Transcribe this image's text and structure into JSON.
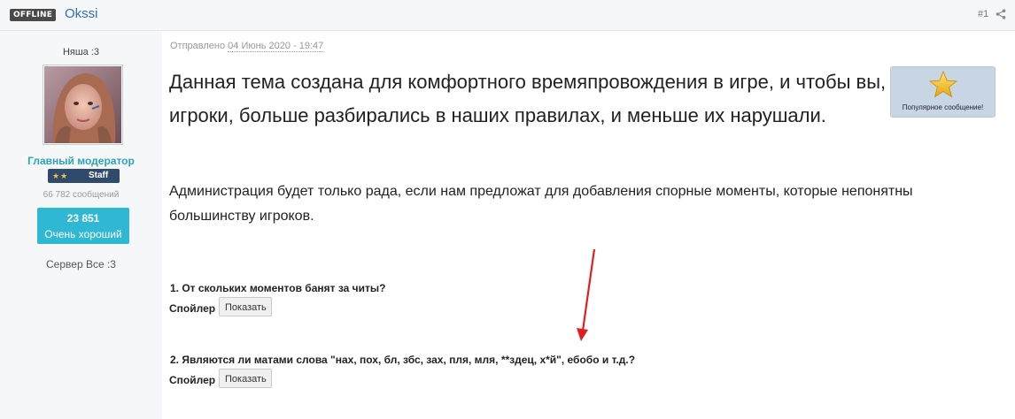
{
  "header": {
    "status_badge": "OFFLINE",
    "username": "Okssi",
    "post_number": "#1",
    "share_icon": "share-icon"
  },
  "user": {
    "title": "Няша :3",
    "avatar": "avatar-photo",
    "role": "Главный модератор",
    "staff_label": "Staff",
    "staff_stars": "★★",
    "messages": "66 782 сообщений",
    "reputation_value": "23 851",
    "reputation_label": "Очень хороший",
    "server": "Сервер Все :3"
  },
  "post": {
    "posted_prefix": "Отправлено",
    "posted_date": "04 Июнь 2020 - 19:47",
    "headline": "Данная тема создана для комфортного времяпровождения в игре, и чтобы вы, игроки, больше разбирались в наших правилах, и меньше их нарушали.",
    "paragraph": "Администрация будет только рада, если нам предложат для добавления спорные моменты, которые непонятны большинству игроков.",
    "popular_label": "Популярное сообщение!",
    "popular_icon": "star-icon",
    "questions": [
      {
        "text": "1. От скольких моментов банят за читы?",
        "spoiler_label": "Спойлер",
        "button_label": "Показать"
      },
      {
        "text": "2. Являются ли матами слова \"нах, пох, бл, збс, зах, пля, мля, **здец, х*й\", ебобо и т.д.?",
        "spoiler_label": "Спойлер",
        "button_label": "Показать"
      }
    ]
  },
  "colors": {
    "accent_link": "#2c6fb7",
    "role_teal": "#2ea4b6",
    "reputation_bg": "#2fb8d4",
    "arrow_red": "#e0201f"
  }
}
